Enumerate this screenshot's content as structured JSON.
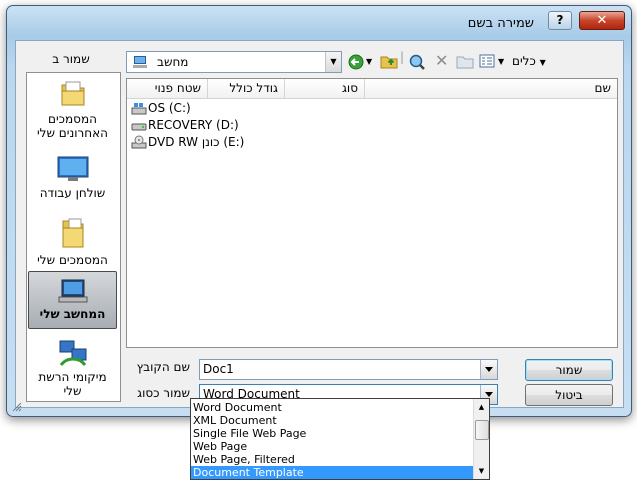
{
  "window": {
    "title": "שמירה בשם",
    "help_label": "?",
    "close_label": "✕"
  },
  "places": {
    "label": "שמור ב",
    "items": [
      {
        "label": "המסמכים האחרונים שלי",
        "icon": "recent-documents-icon"
      },
      {
        "label": "שולחן עבודה",
        "icon": "desktop-icon"
      },
      {
        "label": "המסמכים שלי",
        "icon": "my-documents-icon"
      },
      {
        "label": "המחשב שלי",
        "icon": "my-computer-icon",
        "selected": true
      },
      {
        "label": "מיקומי הרשת שלי",
        "icon": "network-places-icon"
      }
    ]
  },
  "address": {
    "value": "מחשב"
  },
  "toolbar": {
    "tools_label": "כלים"
  },
  "filelist": {
    "columns": [
      "שם",
      "סוג",
      "גודל כולל",
      "שטח פנוי"
    ],
    "drives": [
      {
        "label": "OS (C:)"
      },
      {
        "label": "RECOVERY (D:)"
      },
      {
        "label": "DVD RW כונן (E:)"
      }
    ]
  },
  "form": {
    "filename_label": "שם הקובץ",
    "filename_value": "Doc1",
    "type_label": "שמור כסוג",
    "type_value": "Word Document"
  },
  "buttons": {
    "save": "שמור",
    "cancel": "ביטול"
  },
  "type_options": [
    "Word Document",
    "XML Document",
    "Single File Web Page",
    "Web Page",
    "Web Page, Filtered",
    "Document Template"
  ],
  "selected_type_index": 5,
  "colors": {
    "selection": "#3399ff",
    "frame": "#b9d7ee"
  }
}
